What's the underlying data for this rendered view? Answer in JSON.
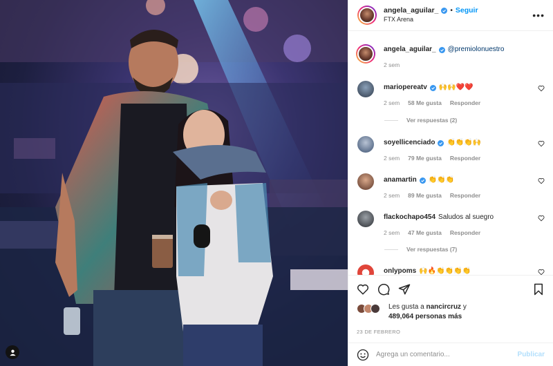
{
  "post": {
    "author": "angela_aguilar_",
    "follow_label": "Seguir",
    "separator": "•",
    "location": "FTX Arena",
    "more_label": "•••"
  },
  "caption": {
    "user": "angela_aguilar_",
    "mention": "@premiolonuestro",
    "age": "2 sem"
  },
  "comments": [
    {
      "user": "mariopereatv",
      "verified": true,
      "text": "🙌🙌❤️❤️",
      "age": "2 sem",
      "likes": "58 Me gusta",
      "reply": "Responder",
      "replies": "Ver respuestas (2)"
    },
    {
      "user": "soyellicenciado",
      "verified": true,
      "text": "👏👏👏🙌",
      "age": "2 sem",
      "likes": "79 Me gusta",
      "reply": "Responder"
    },
    {
      "user": "anamartin",
      "verified": true,
      "text": "👏👏👏",
      "age": "2 sem",
      "likes": "89 Me gusta",
      "reply": "Responder"
    },
    {
      "user": "flackochapo454",
      "verified": false,
      "text": "Saludos al suegro",
      "age": "2 sem",
      "likes": "47 Me gusta",
      "reply": "Responder",
      "replies": "Ver respuestas (7)"
    },
    {
      "user": "onlypoms",
      "verified": false,
      "text": "🙌🔥👏👏👏👏"
    }
  ],
  "likes": {
    "prefix": "Les gusta a ",
    "user": "nancircruz",
    "joiner": " y",
    "count": "489,064 personas más"
  },
  "date": "23 DE FEBRERO",
  "comment_box": {
    "placeholder": "Agrega un comentario...",
    "publish": "Publicar"
  },
  "colors": {
    "link": "#0095f6",
    "mention": "#00376b",
    "muted": "#8e8e8e",
    "verified": "#3897f0"
  },
  "icons": [
    "heart-icon",
    "comment-icon",
    "share-icon",
    "bookmark-icon",
    "emoji-icon",
    "user-tag-icon",
    "verified-badge-icon"
  ]
}
